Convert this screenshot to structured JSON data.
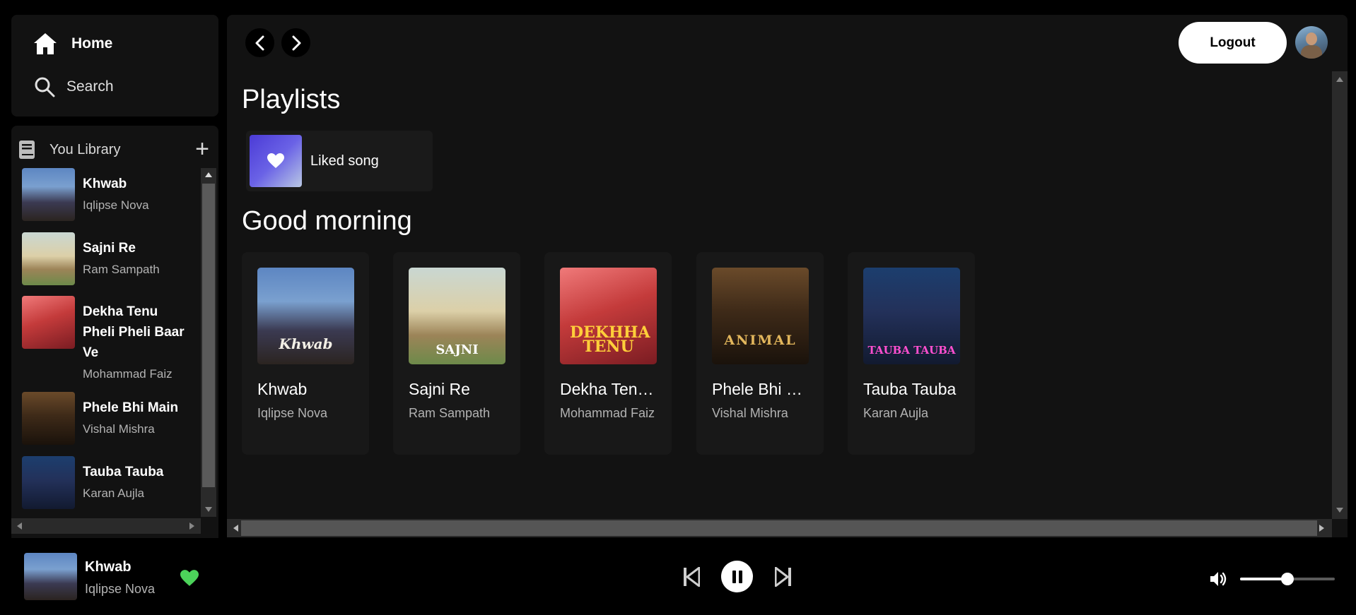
{
  "nav": {
    "home_label": "Home",
    "search_label": "Search"
  },
  "library": {
    "title": "You Library",
    "add_label": "+",
    "items": [
      {
        "name": "Khwab",
        "artist": "Iqlipse Nova"
      },
      {
        "name": "Sajni Re",
        "artist": "Ram Sampath"
      },
      {
        "name": "Dekha Tenu Pheli Pheli Baar Ve",
        "artist": "Mohammad Faiz"
      },
      {
        "name": "Phele Bhi Main",
        "artist": "Vishal Mishra"
      },
      {
        "name": "Tauba Tauba",
        "artist": "Karan Aujla"
      }
    ]
  },
  "header": {
    "logout_label": "Logout"
  },
  "playlists": {
    "title": "Playlists",
    "liked_label": "Liked song"
  },
  "greeting": {
    "title": "Good morning"
  },
  "cards": [
    {
      "name": "Khwab",
      "artist": "Iqlipse Nova",
      "art_text": "Khwab"
    },
    {
      "name": "Sajni Re",
      "artist": "Ram Sampath",
      "art_text": "SAJNI"
    },
    {
      "name": "Dekha Tenu Pheli Pheli Baar Ve",
      "artist": "Mohammad Faiz",
      "art_text": "DEKHHA TENU"
    },
    {
      "name": "Phele Bhi Main",
      "artist": "Vishal Mishra",
      "art_text": "ANIMAL"
    },
    {
      "name": "Tauba Tauba",
      "artist": "Karan Aujla",
      "art_text": "TAUBA TAUBA"
    }
  ],
  "player": {
    "now_playing": {
      "name": "Khwab",
      "artist": "Iqlipse Nova"
    },
    "liked": true,
    "state": "playing",
    "volume": 0.5
  },
  "colors": {
    "accent_green": "#4cd35a",
    "panel": "#121212",
    "card": "#181818"
  },
  "icons": [
    "home-icon",
    "search-icon",
    "library-icon",
    "plus-icon",
    "chevron-left-icon",
    "chevron-right-icon",
    "heart-icon",
    "skip-back-icon",
    "pause-icon",
    "skip-forward-icon",
    "volume-icon"
  ]
}
